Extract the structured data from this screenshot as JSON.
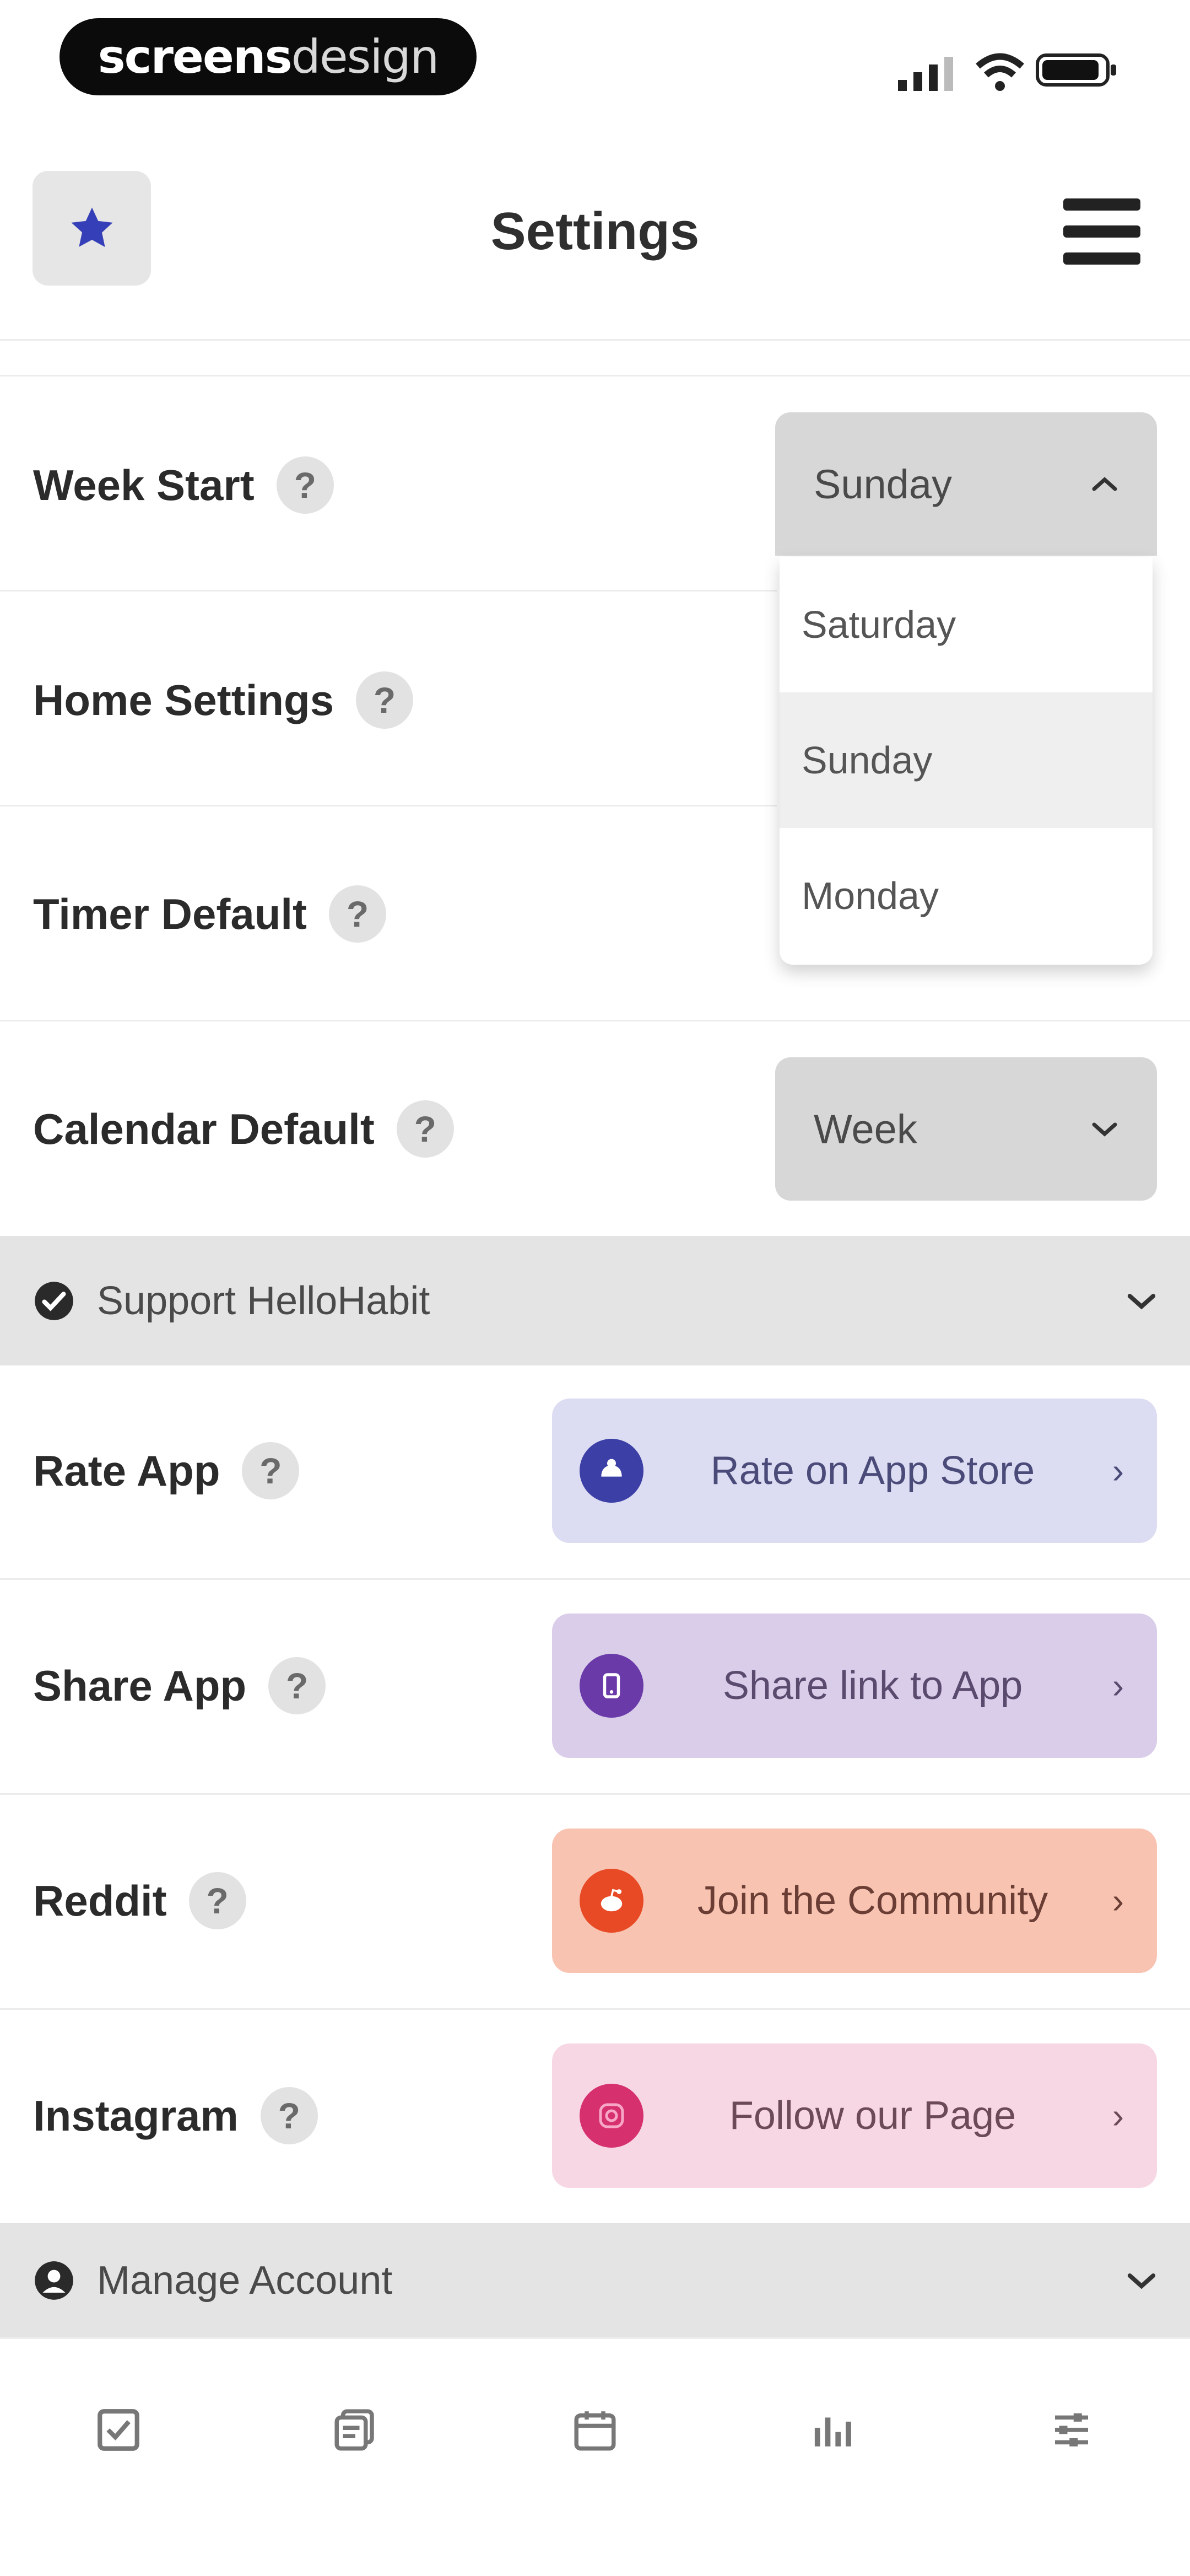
{
  "status_bar": {
    "brand_part1": "screens",
    "brand_part2": "design"
  },
  "header": {
    "title": "Settings",
    "left_icon": "star-icon",
    "right_icon": "hamburger-menu-icon"
  },
  "settings": {
    "week_start": {
      "label": "Week Start",
      "help": "?",
      "value": "Sunday",
      "options": [
        "Saturday",
        "Sunday",
        "Monday"
      ],
      "selected_index": 1
    },
    "home_settings": {
      "label": "Home Settings",
      "help": "?"
    },
    "timer_default": {
      "label": "Timer Default",
      "help": "?"
    },
    "calendar_default": {
      "label": "Calendar Default",
      "help": "?",
      "value": "Week"
    }
  },
  "support_section": {
    "title": "Support HelloHabit",
    "icon": "check-circle-icon",
    "rows": [
      {
        "label": "Rate App",
        "help": "?",
        "button": "Rate on App Store",
        "bg": "#dcdcf2",
        "circle": "#3b3fa6",
        "text": "#4b4b7a"
      },
      {
        "label": "Share App",
        "help": "?",
        "button": "Share link to App",
        "bg": "#d9cdea",
        "circle": "#6a3aa8",
        "text": "#5a4b6e"
      },
      {
        "label": "Reddit",
        "help": "?",
        "button": "Join the Community",
        "bg": "#f9c3b2",
        "circle": "#e84a25",
        "text": "#6a3e34"
      },
      {
        "label": "Instagram",
        "help": "?",
        "button": "Follow our Page",
        "bg": "#f7d7e4",
        "circle": "#d6306e",
        "text": "#6d4a58"
      }
    ]
  },
  "account_section": {
    "title": "Manage Account",
    "icon": "user-circle-icon"
  },
  "tab_bar": {
    "tabs": [
      "checklist-icon",
      "notes-icon",
      "calendar-icon",
      "stats-icon",
      "sliders-icon"
    ]
  },
  "colors": {
    "accent_star": "#3540b8"
  }
}
